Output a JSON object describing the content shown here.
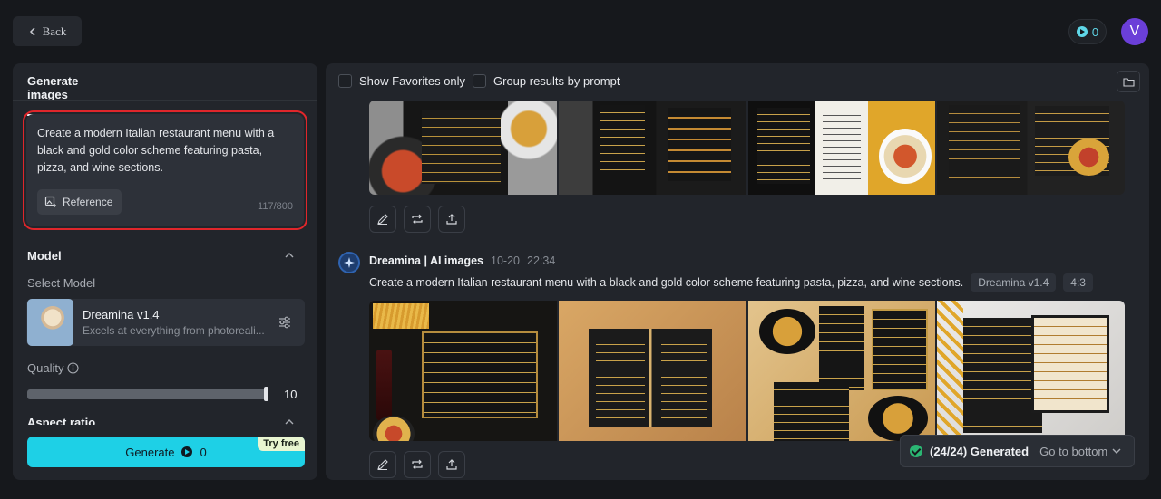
{
  "header": {
    "back_label": "Back",
    "credits": "0",
    "avatar_initial": "V"
  },
  "left_panel": {
    "tab_label": "Generate images",
    "prompt": "Create a modern Italian restaurant menu with a black and gold color scheme featuring pasta, pizza, and wine sections.",
    "reference_label": "Reference",
    "char_count": "117/800",
    "model_section_title": "Model",
    "select_model_label": "Select Model",
    "model_name": "Dreamina v1.4",
    "model_desc": "Excels at everything from photoreali...",
    "quality_label": "Quality",
    "quality_value": "10",
    "quality_level": 1.0,
    "aspect_ratio_label": "Aspect ratio",
    "generate_label": "Generate",
    "generate_cost": "0",
    "try_free_label": "Try free"
  },
  "right_panel": {
    "show_favorites_label": "Show Favorites only",
    "group_results_label": "Group results by prompt",
    "generation": {
      "author": "Dreamina | AI images",
      "date": "10-20",
      "time": "22:34",
      "prompt": "Create a modern Italian restaurant menu with a black and gold color scheme featuring pasta, pizza, and wine sections.",
      "model_tag": "Dreamina v1.4",
      "ratio_tag": "4:3"
    },
    "status": {
      "generated_label": "(24/24) Generated",
      "goto_label": "Go to bottom"
    }
  },
  "colors": {
    "accent": "#1ed0e6",
    "highlight_border": "#e0262b",
    "avatar": "#6b3fd8"
  }
}
